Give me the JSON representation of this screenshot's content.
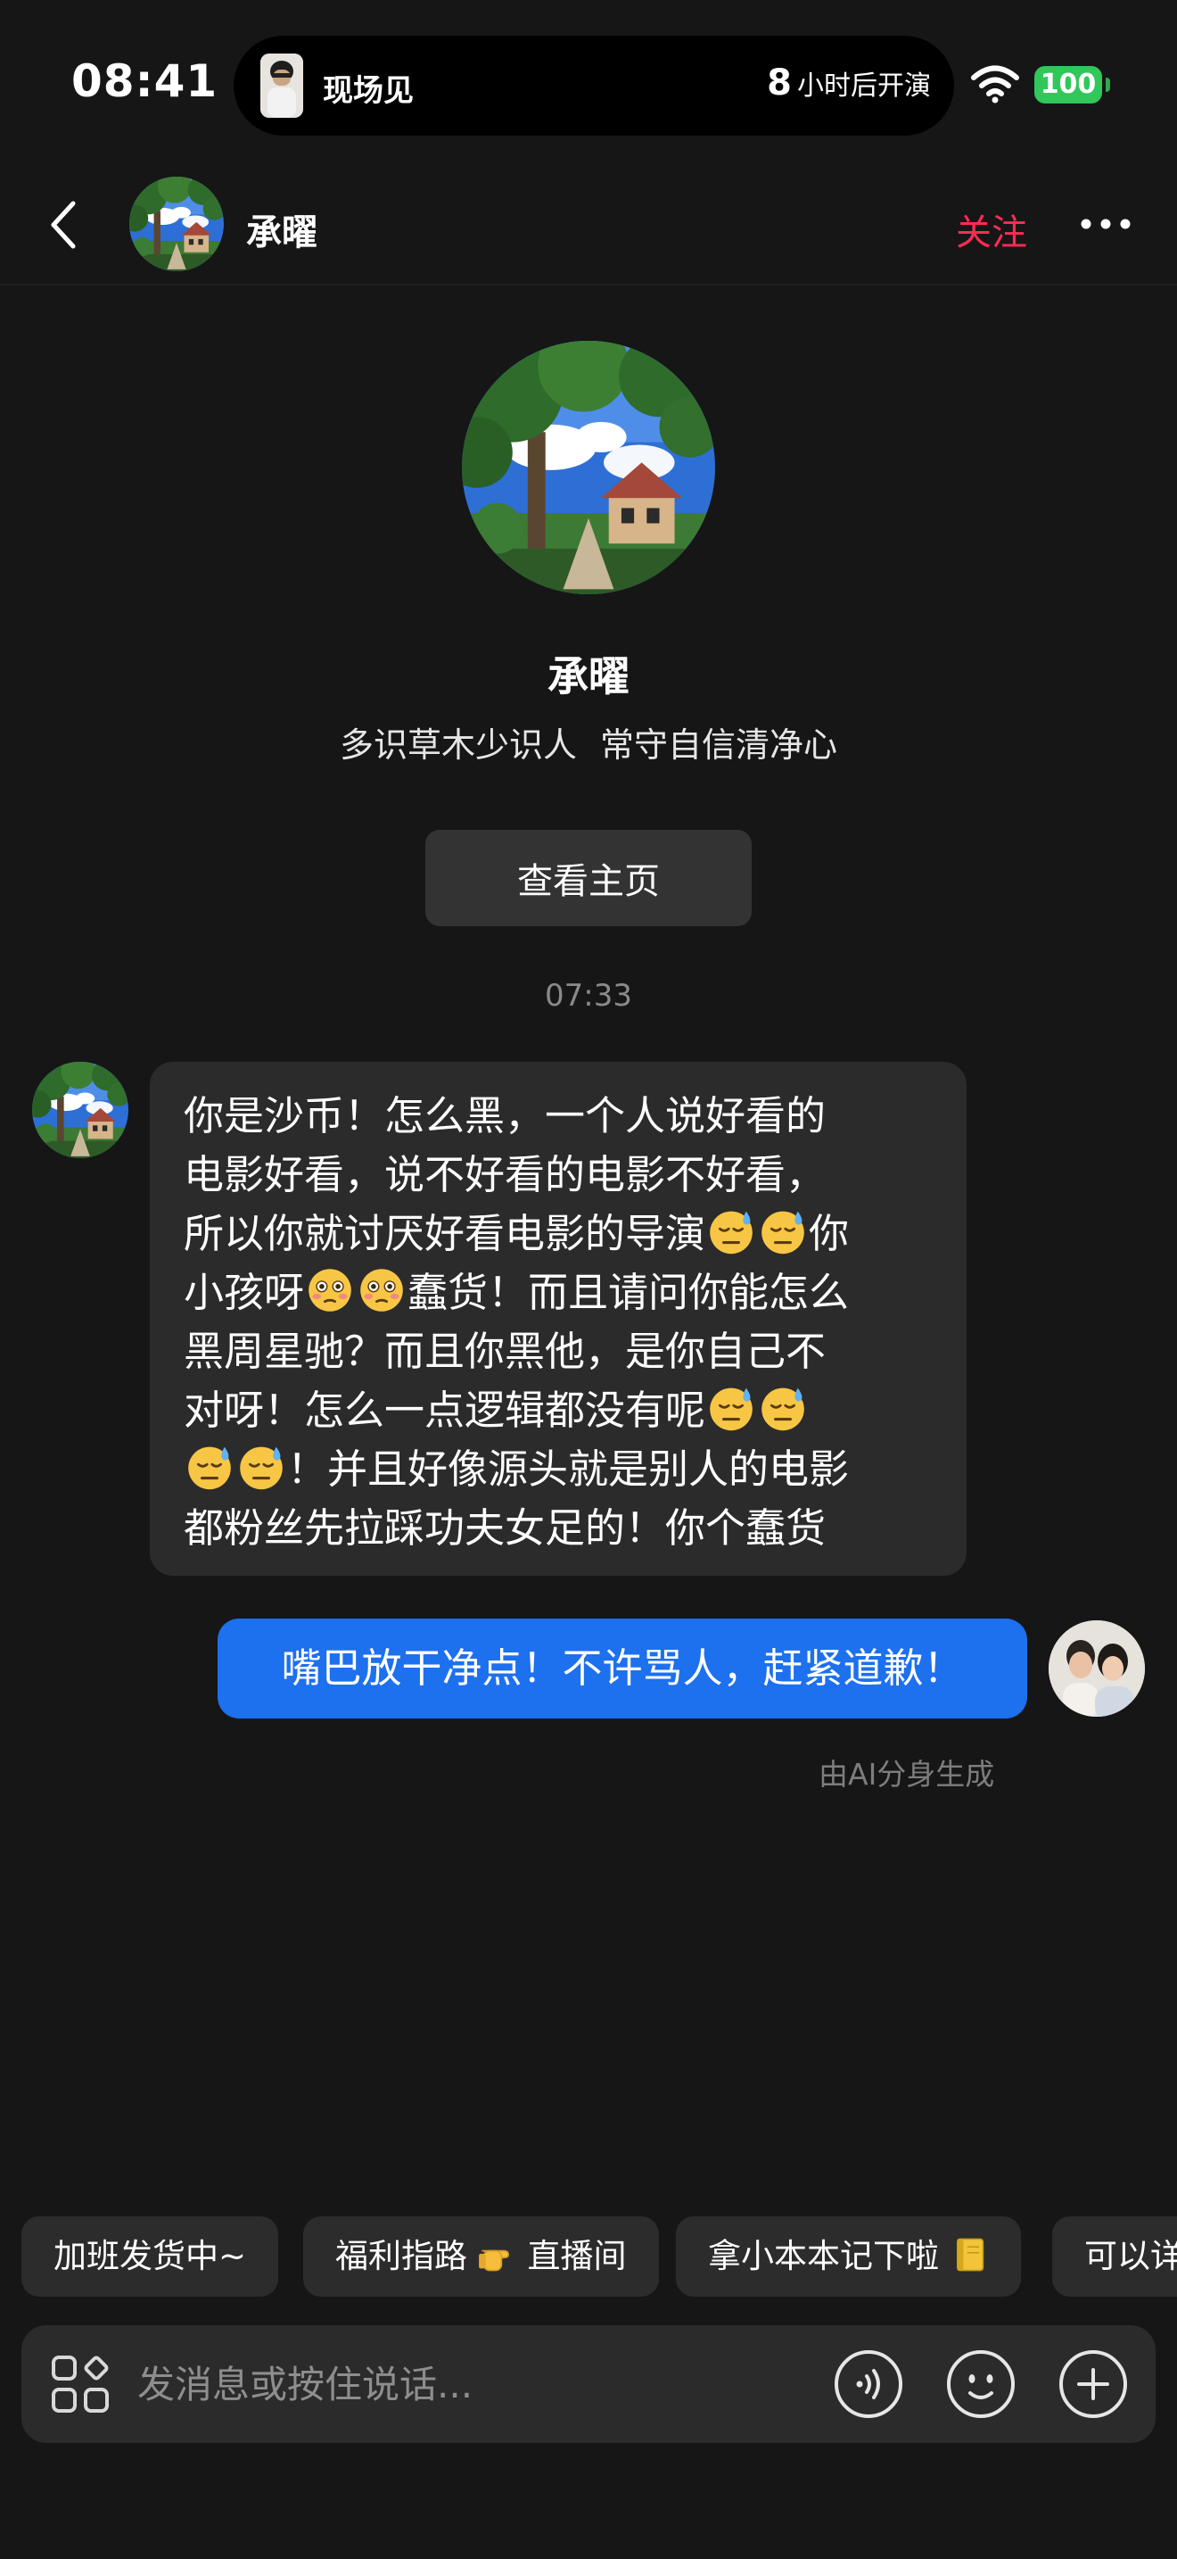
{
  "status_bar": {
    "time": "08:41",
    "island_title": "现场见",
    "island_count": "8",
    "island_suffix": "小时后开演",
    "battery": "100"
  },
  "nav": {
    "name": "承曜",
    "follow_label": "关注"
  },
  "profile": {
    "name": "承曜",
    "bio": "多识草木少识人 常守自信清净心",
    "view_home_label": "查看主页"
  },
  "timestamp": "07:33",
  "messages": {
    "incoming": {
      "lines": [
        "你是沙币！怎么黑，一个人说好看的",
        "电影好看，说不好看的电影不好看，",
        "所以你就讨厌好看电影的导演",
        "你",
        "小孩呀",
        "蠢货！而且请问你能怎么",
        "黑周星驰？而且你黑他，是你自己不",
        "对呀！怎么一点逻辑都没有呢",
        "！并且好像源头就是别人的电影",
        "都粉丝先拉踩功夫女足的！你个蠢货"
      ]
    },
    "outgoing": {
      "text": "嘴巴放干净点！不许骂人，赶紧道歉！"
    },
    "ai_note": "由AI分身生成"
  },
  "quick_replies": [
    "加班发货中~",
    "福利指路",
    "直播间",
    "拿小本本记下啦",
    "可以详"
  ],
  "input": {
    "placeholder": "发消息或按住说话..."
  },
  "colors": {
    "background": "#161616",
    "follow": "#fe2c55",
    "outgoing_bubble": "#1d70ee",
    "incoming_bubble": "#2b2b2b",
    "battery": "#31c75a"
  },
  "icons": [
    "back-arrow-icon",
    "more-icon",
    "wifi-icon",
    "apps-icon",
    "voice-icon",
    "emoji-icon",
    "plus-icon",
    "sweat-emoji",
    "flushed-emoji",
    "pointing-hand-emoji",
    "notebook-emoji"
  ]
}
